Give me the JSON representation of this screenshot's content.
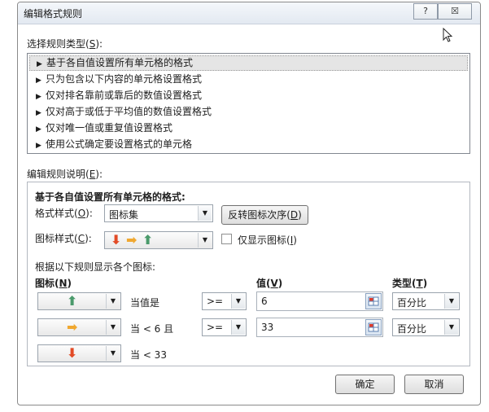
{
  "dialog": {
    "title": "编辑格式规则",
    "help_label": "?",
    "close_label": "☒"
  },
  "rule_type": {
    "label": "选择规则类型(",
    "label_key": "S",
    "label_end": "):",
    "items": [
      "基于各自值设置所有单元格的格式",
      "只为包含以下内容的单元格设置格式",
      "仅对排名靠前或靠后的数值设置格式",
      "仅对高于或低于平均值的数值设置格式",
      "仅对唯一值或重复值设置格式",
      "使用公式确定要设置格式的单元格"
    ],
    "selected_index": 0,
    "bullet": "▶"
  },
  "description": {
    "label": "编辑规则说明(",
    "label_key": "E",
    "label_end": "):",
    "heading": "基于各自值设置所有单元格的格式:",
    "format_style_label": "格式样式(",
    "format_style_key": "O",
    "format_style_end": "):",
    "format_style_value": "图标集",
    "reverse_label": "反转图标次序(",
    "reverse_key": "D",
    "reverse_end": ")",
    "icon_style_label": "图标样式(",
    "icon_style_key": "C",
    "icon_style_end": "):",
    "show_icon_only_label": "仅显示图标(",
    "show_icon_only_key": "I",
    "show_icon_only_end": ")",
    "show_icon_only_checked": false,
    "rules_caption": "根据以下规则显示各个图标:",
    "col_icon": "图标",
    "col_icon_key": "N",
    "col_value": "值",
    "col_value_key": "V",
    "col_type": "类型",
    "col_type_key": "T"
  },
  "icon_rules": [
    {
      "icon": "green-up-arrow-icon",
      "glyph": "⬆",
      "color": "#4a9a6b",
      "condition": "当值是",
      "operator": ">=",
      "value": "6",
      "type": "百分比"
    },
    {
      "icon": "yellow-right-arrow-icon",
      "glyph": "➡",
      "color": "#f0a830",
      "condition": "当 < 6 且",
      "operator": ">=",
      "value": "33",
      "type": "百分比"
    },
    {
      "icon": "red-down-arrow-icon",
      "glyph": "⬇",
      "color": "#e24b26",
      "condition": "当 < 33"
    }
  ],
  "footer": {
    "ok_label": "确定",
    "cancel_label": "取消"
  },
  "colors": {
    "up_arrow": "#4a9a6b",
    "right_arrow": "#f0a830",
    "down_arrow": "#e24b26"
  }
}
